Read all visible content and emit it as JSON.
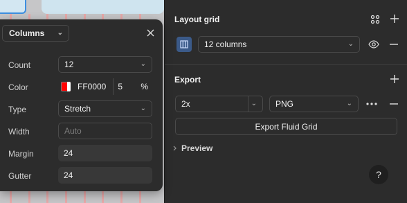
{
  "layout_grid": {
    "title": "Layout grid",
    "grid_select": "12 columns"
  },
  "export": {
    "title": "Export",
    "scale": "2x",
    "format": "PNG",
    "button": "Export Fluid Grid"
  },
  "preview": {
    "label": "Preview"
  },
  "help": {
    "label": "?"
  },
  "popover": {
    "type_dropdown": "Columns",
    "rows": {
      "count": {
        "label": "Count",
        "value": "12"
      },
      "color": {
        "label": "Color",
        "hex": "FF0000",
        "opacity": "5",
        "unit": "%"
      },
      "type": {
        "label": "Type",
        "value": "Stretch"
      },
      "width": {
        "label": "Width",
        "placeholder": "Auto"
      },
      "margin": {
        "label": "Margin",
        "value": "24"
      },
      "gutter": {
        "label": "Gutter",
        "value": "24"
      }
    }
  },
  "colors": {
    "grid_color": "#FF0000",
    "accent_tile": "#3b5a89",
    "selection_blue": "#3d8fe0"
  }
}
